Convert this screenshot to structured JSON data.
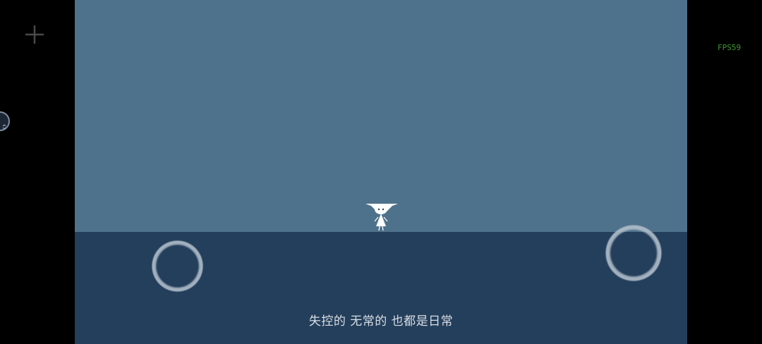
{
  "game": {
    "subtitle": "失控的 无常的 也都是日常",
    "fps_label": "FPS59",
    "colors": {
      "sky": "#4f728c",
      "ground": "#243f5c",
      "letterbox": "#000000",
      "subtitle": "#d9dee4",
      "fps": "#3c9a2c",
      "joystick_ring": "#b3c0cc"
    }
  },
  "controls": {
    "left_joystick_icon": "virtual-joystick-ring",
    "right_joystick_icon": "action-button-ring",
    "menu_icon": "plus-icon",
    "side_toggle_icon": "expand-arrows-icon"
  }
}
